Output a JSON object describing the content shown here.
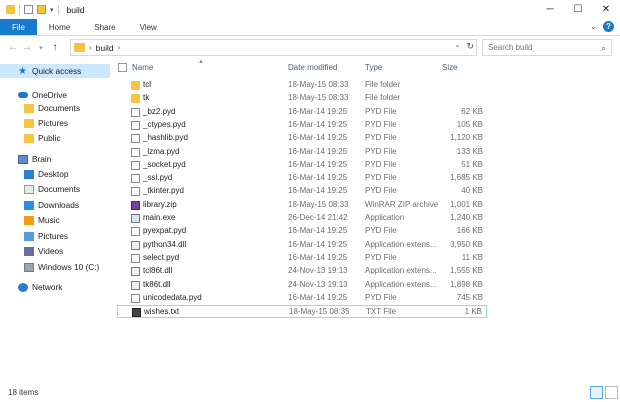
{
  "window": {
    "title": "build"
  },
  "ribbon": {
    "tabs": [
      "File",
      "Home",
      "Share",
      "View"
    ]
  },
  "address": {
    "crumbs": [
      "build"
    ]
  },
  "search": {
    "placeholder": "Search build"
  },
  "nav": [
    {
      "label": "Quick access",
      "icon": "star-icon",
      "level": 0,
      "selected": true
    },
    {
      "label": "OneDrive",
      "icon": "cloud-icon",
      "level": 0
    },
    {
      "label": "Documents",
      "icon": "folder-icon",
      "level": 1
    },
    {
      "label": "Pictures",
      "icon": "folder-icon",
      "level": 1
    },
    {
      "label": "Public",
      "icon": "folder-icon",
      "level": 1
    },
    {
      "label": "Brain",
      "icon": "computer-icon",
      "level": 0
    },
    {
      "label": "Desktop",
      "icon": "desktop-icon",
      "level": 1
    },
    {
      "label": "Documents",
      "icon": "documents-icon",
      "level": 1
    },
    {
      "label": "Downloads",
      "icon": "downloads-icon",
      "level": 1
    },
    {
      "label": "Music",
      "icon": "music-icon",
      "level": 1
    },
    {
      "label": "Pictures",
      "icon": "pictures-icon",
      "level": 1
    },
    {
      "label": "Videos",
      "icon": "videos-icon",
      "level": 1
    },
    {
      "label": "Windows 10 (C:)",
      "icon": "drive-icon",
      "level": 1
    },
    {
      "label": "Network",
      "icon": "network-icon",
      "level": 0
    }
  ],
  "columns": {
    "name": "Name",
    "date": "Date modified",
    "type": "Type",
    "size": "Size"
  },
  "files": [
    {
      "name": "tcl",
      "date": "18-May-15 08:33",
      "type": "File folder",
      "size": "",
      "icon": "folder-icon"
    },
    {
      "name": "tk",
      "date": "18-May-15 08:33",
      "type": "File folder",
      "size": "",
      "icon": "folder-icon"
    },
    {
      "name": "_bz2.pyd",
      "date": "16-Mar-14 19:25",
      "type": "PYD File",
      "size": "62 KB",
      "icon": "file-icon"
    },
    {
      "name": "_ctypes.pyd",
      "date": "16-Mar-14 19:25",
      "type": "PYD File",
      "size": "105 KB",
      "icon": "file-icon"
    },
    {
      "name": "_hashlib.pyd",
      "date": "16-Mar-14 19:25",
      "type": "PYD File",
      "size": "1,120 KB",
      "icon": "file-icon"
    },
    {
      "name": "_lzma.pyd",
      "date": "16-Mar-14 19:25",
      "type": "PYD File",
      "size": "133 KB",
      "icon": "file-icon"
    },
    {
      "name": "_socket.pyd",
      "date": "16-Mar-14 19:25",
      "type": "PYD File",
      "size": "51 KB",
      "icon": "file-icon"
    },
    {
      "name": "_ssl.pyd",
      "date": "16-Mar-14 19:25",
      "type": "PYD File",
      "size": "1,685 KB",
      "icon": "file-icon"
    },
    {
      "name": "_tkinter.pyd",
      "date": "16-Mar-14 19:25",
      "type": "PYD File",
      "size": "40 KB",
      "icon": "file-icon"
    },
    {
      "name": "library.zip",
      "date": "18-May-15 08:33",
      "type": "WinRAR ZIP archive",
      "size": "1,001 KB",
      "icon": "archive-icon"
    },
    {
      "name": "main.exe",
      "date": "26-Dec-14 21:42",
      "type": "Application",
      "size": "1,240 KB",
      "icon": "exe-icon"
    },
    {
      "name": "pyexpat.pyd",
      "date": "16-Mar-14 19:25",
      "type": "PYD File",
      "size": "166 KB",
      "icon": "file-icon"
    },
    {
      "name": "python34.dll",
      "date": "16-Mar-14 19:25",
      "type": "Application extens...",
      "size": "3,950 KB",
      "icon": "dll-icon"
    },
    {
      "name": "select.pyd",
      "date": "16-Mar-14 19:25",
      "type": "PYD File",
      "size": "11 KB",
      "icon": "file-icon"
    },
    {
      "name": "tcl86t.dll",
      "date": "24-Nov-13 19:13",
      "type": "Application extens...",
      "size": "1,555 KB",
      "icon": "dll-icon"
    },
    {
      "name": "tk86t.dll",
      "date": "24-Nov-13 19:13",
      "type": "Application extens...",
      "size": "1,898 KB",
      "icon": "dll-icon"
    },
    {
      "name": "unicodedata.pyd",
      "date": "16-Mar-14 19:25",
      "type": "PYD File",
      "size": "745 KB",
      "icon": "file-icon"
    },
    {
      "name": "wishes.txt",
      "date": "18-May-15 08:35",
      "type": "TXT File",
      "size": "1 KB",
      "icon": "txt-icon",
      "selected": true
    }
  ],
  "status": {
    "count": "18 items"
  },
  "colors": {
    "accent": "#1979ca",
    "folder": "#f5c542",
    "selection": "#cce8ff",
    "header": "#4c607a"
  }
}
